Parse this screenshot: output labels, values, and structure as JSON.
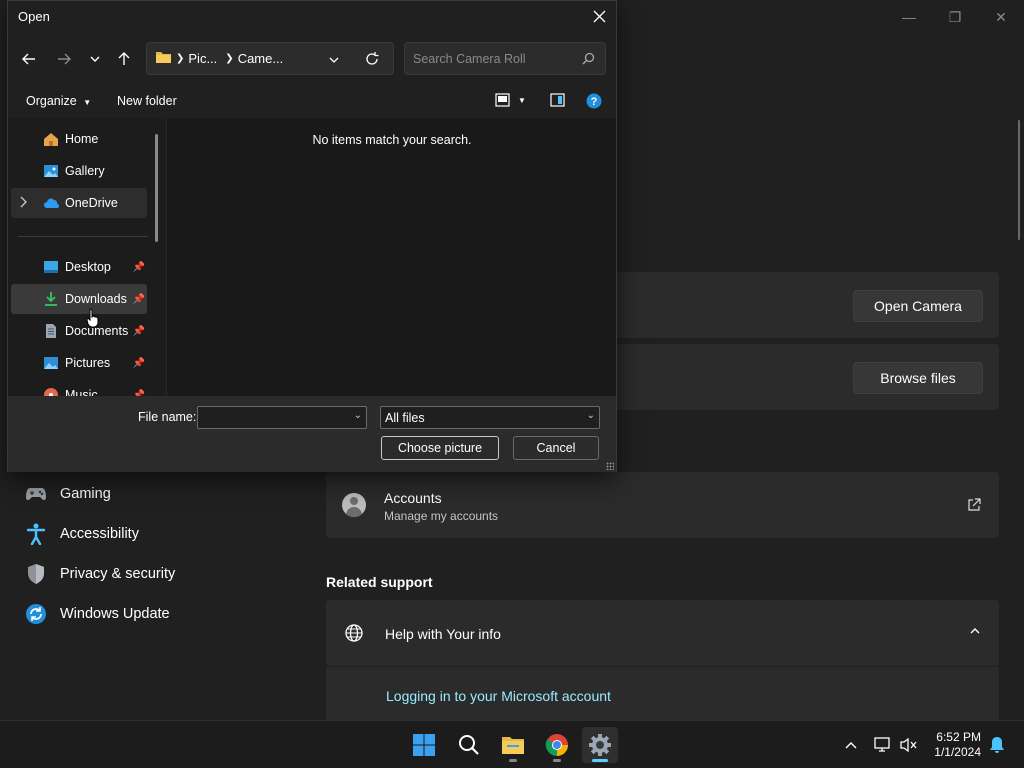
{
  "settings": {
    "open_camera": "Open Camera",
    "browse_files": "Browse files",
    "nav": [
      {
        "label": "Gaming",
        "icon": "gamepad-icon"
      },
      {
        "label": "Accessibility",
        "icon": "accessibility-icon"
      },
      {
        "label": "Privacy & security",
        "icon": "shield-icon"
      },
      {
        "label": "Windows Update",
        "icon": "update-icon"
      }
    ],
    "accounts_title": "Accounts",
    "accounts_sub": "Manage my accounts",
    "related_support": "Related support",
    "help_title": "Help with Your info",
    "link_ms_account": "Logging in to your Microsoft account"
  },
  "dialog": {
    "title": "Open",
    "breadcrumb": [
      "Pic...",
      "Came..."
    ],
    "search_placeholder": "Search Camera Roll",
    "organize": "Organize",
    "new_folder": "New folder",
    "tree": [
      {
        "label": "Home"
      },
      {
        "label": "Gallery"
      },
      {
        "label": "OneDrive"
      },
      {
        "label": "Desktop"
      },
      {
        "label": "Downloads"
      },
      {
        "label": "Documents"
      },
      {
        "label": "Pictures"
      },
      {
        "label": "Music"
      }
    ],
    "empty_message": "No items match your search.",
    "file_name_label": "File name:",
    "file_name_value": "",
    "file_type": "All files",
    "choose_btn": "Choose picture",
    "cancel_btn": "Cancel"
  },
  "taskbar": {
    "time": "6:52 PM",
    "date": "1/1/2024"
  },
  "colors": {
    "accent": "#60cdff",
    "link": "#99ebff"
  }
}
